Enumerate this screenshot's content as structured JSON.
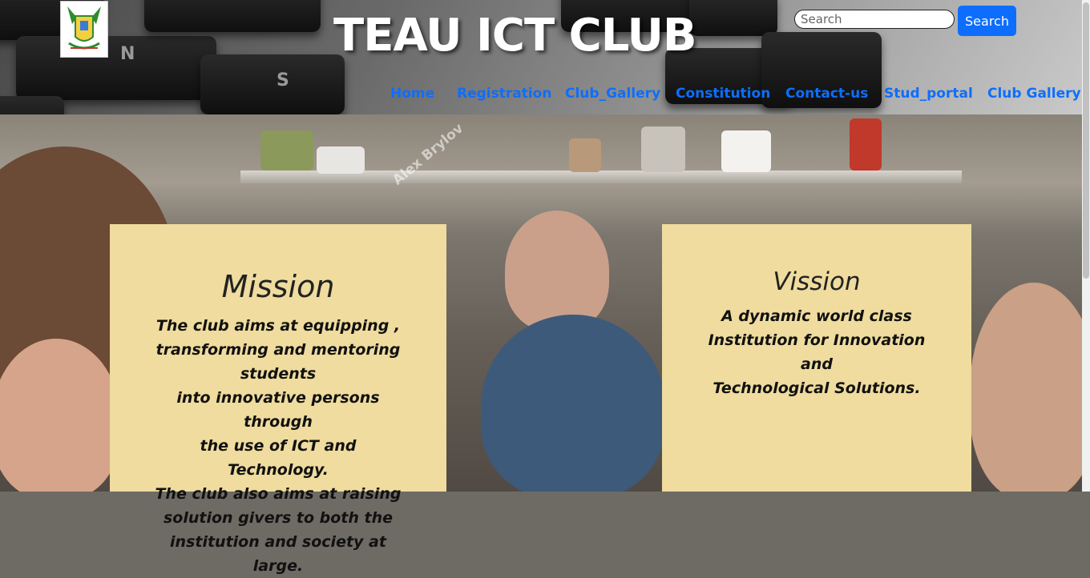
{
  "header": {
    "logo_alt": "TEAU crest logo",
    "title": "TEAU ICT CLUB",
    "search": {
      "placeholder": "Search",
      "value": "",
      "button_label": "Search"
    }
  },
  "nav": {
    "items": [
      {
        "label": "Home"
      },
      {
        "label": "Registration"
      },
      {
        "label": "Club_Gallery"
      },
      {
        "label": "Constitution"
      },
      {
        "label": "Contact-us"
      },
      {
        "label": "Stud_portal"
      },
      {
        "label": "Club Gallery"
      }
    ]
  },
  "watermark": "Alex Brylov",
  "mission": {
    "title": "Mission",
    "lines": [
      "The club aims at equipping ,",
      "transforming and mentoring",
      "students",
      "into innovative persons through",
      "the use of ICT and Technology.",
      "The club also aims at raising",
      "solution givers to both the",
      "institution and society at large."
    ]
  },
  "vision": {
    "title": "Vission",
    "lines": [
      "A dynamic world class",
      "Institution for Innovation and",
      "Technological Solutions."
    ]
  },
  "colors": {
    "nav_link": "#0d6efd",
    "card_bg": "#efdc9e",
    "search_button": "#0d6efd"
  }
}
